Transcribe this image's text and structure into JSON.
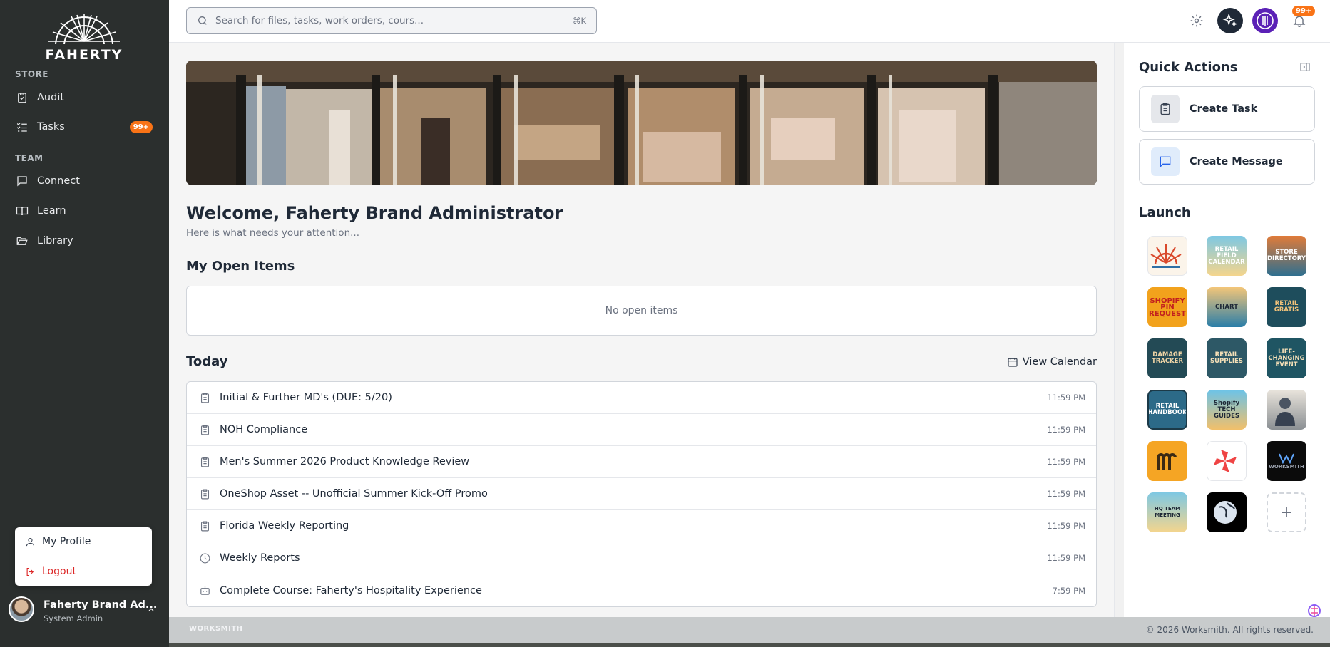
{
  "brand": {
    "logo_text": "FAHERTY"
  },
  "sidebar": {
    "sections": [
      {
        "label": "STORE"
      },
      {
        "label": "TEAM"
      }
    ],
    "items": [
      {
        "label": "Audit",
        "icon": "clipboard-check-icon"
      },
      {
        "label": "Tasks",
        "icon": "list-checks-icon",
        "badge": "99+"
      },
      {
        "label": "Connect",
        "icon": "message-square-icon"
      },
      {
        "label": "Learn",
        "icon": "book-open-icon"
      },
      {
        "label": "Library",
        "icon": "folder-open-icon"
      }
    ],
    "profile_menu": [
      {
        "label": "My Profile",
        "icon": "user-icon"
      },
      {
        "label": "Logout",
        "icon": "logout-icon"
      }
    ],
    "user": {
      "name": "Faherty Brand Ad...",
      "role": "System Admin"
    }
  },
  "search": {
    "placeholder": "Search for files, tasks, work orders, cours...",
    "shortcut": "⌘K"
  },
  "topbar": {
    "notifications_badge": "99+"
  },
  "main": {
    "welcome": "Welcome, Faherty Brand Administrator",
    "subtitle": "Here is what needs your attention...",
    "open_items": {
      "heading": "My Open Items",
      "empty_text": "No open items"
    },
    "today": {
      "heading": "Today",
      "view_calendar": "View Calendar",
      "items": [
        {
          "title": "Initial & Further MD's (DUE: 5/20)",
          "time": "11:59 PM",
          "icon": "clipboard-icon"
        },
        {
          "title": "NOH Compliance",
          "time": "11:59 PM",
          "icon": "clipboard-icon"
        },
        {
          "title": "Men's Summer 2026 Product Knowledge Review",
          "time": "11:59 PM",
          "icon": "clipboard-icon"
        },
        {
          "title": "OneShop Asset -- Unofficial Summer Kick-Off Promo",
          "time": "11:59 PM",
          "icon": "clipboard-icon"
        },
        {
          "title": "Florida Weekly Reporting",
          "time": "11:59 PM",
          "icon": "clipboard-icon"
        },
        {
          "title": "Weekly Reports",
          "time": "11:59 PM",
          "icon": "clock-icon"
        },
        {
          "title": "Complete Course: Faherty's Hospitality Experience",
          "time": "7:59 PM",
          "icon": "bot-icon"
        }
      ]
    }
  },
  "right_panel": {
    "quick_actions_title": "Quick Actions",
    "quick_actions": [
      {
        "label": "Create Task",
        "icon": "clipboard-list-icon"
      },
      {
        "label": "Create Message",
        "icon": "message-icon"
      }
    ],
    "launch_title": "Launch",
    "launch_tiles": [
      {
        "label": "",
        "name": "sunrise-app"
      },
      {
        "label": "RETAIL FIELD CALENDAR",
        "name": "retail-field-calendar-app"
      },
      {
        "label": "STORE DIRECTORY",
        "name": "store-directory-app"
      },
      {
        "label": "SHOPIFY PIN REQUEST",
        "name": "shopify-pin-request-app"
      },
      {
        "label": "CHART",
        "name": "chart-app"
      },
      {
        "label": "RETAIL GRATIS",
        "name": "retail-gratis-app"
      },
      {
        "label": "DAMAGE TRACKER",
        "name": "damage-tracker-app"
      },
      {
        "label": "RETAIL SUPPLIES",
        "name": "retail-supplies-app"
      },
      {
        "label": "LIFE-CHANGING EVENT",
        "name": "life-changing-event-app"
      },
      {
        "label": "RETAIL HANDBOOK",
        "name": "retail-handbook-app"
      },
      {
        "label": "Shopify TECH GUIDES",
        "name": "shopify-tech-guides-app"
      },
      {
        "label": "",
        "name": "person-app"
      },
      {
        "label": "",
        "name": "orange-app"
      },
      {
        "label": "",
        "name": "pinwheel-app"
      },
      {
        "label": "WORKSMITH",
        "name": "worksmith-app"
      },
      {
        "label": "HQ TEAM MEETING",
        "name": "hq-team-meeting-app"
      },
      {
        "label": "",
        "name": "globe-app"
      },
      {
        "label": "+",
        "name": "add-app"
      }
    ]
  },
  "footer": {
    "logo": "WORKSMITH",
    "copyright": "© 2026 Worksmith. All rights reserved."
  },
  "colors": {
    "sidebar_bg": "#2b2f2e",
    "accent_badge": "#f97316",
    "logout_red": "#dc2626"
  }
}
